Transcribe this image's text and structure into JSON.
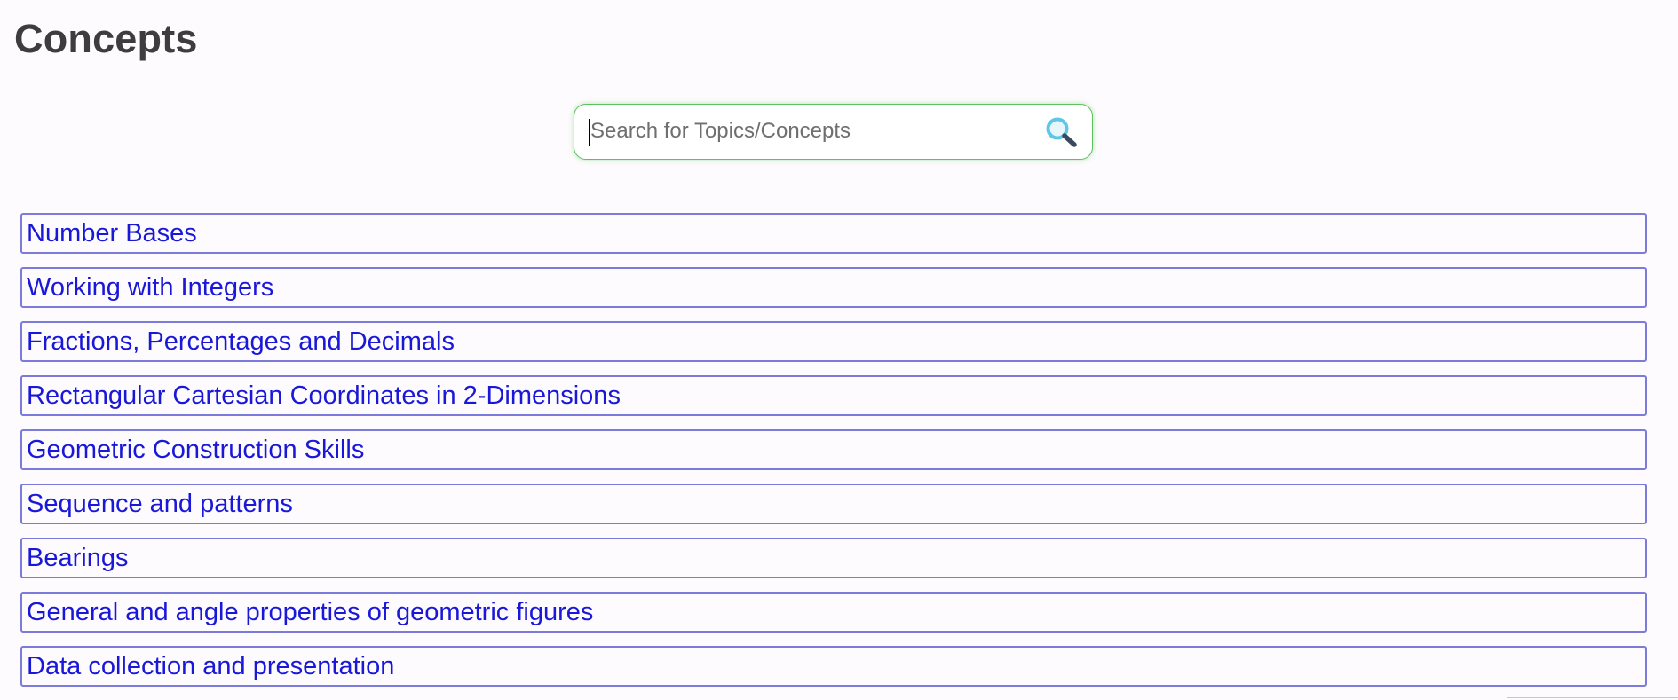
{
  "header": {
    "title": "Concepts"
  },
  "search": {
    "placeholder": "Search for Topics/Concepts",
    "value": "",
    "icon": "search-icon"
  },
  "concepts": [
    {
      "label": "Number Bases"
    },
    {
      "label": "Working with Integers"
    },
    {
      "label": "Fractions, Percentages and Decimals"
    },
    {
      "label": "Rectangular Cartesian Coordinates in 2-Dimensions"
    },
    {
      "label": "Geometric Construction Skills"
    },
    {
      "label": "Sequence and patterns"
    },
    {
      "label": "Bearings"
    },
    {
      "label": "General and angle properties of geometric figures"
    },
    {
      "label": "Data collection and presentation"
    }
  ],
  "colors": {
    "title": "#3d3d3d",
    "link": "#1a18d8",
    "item_border": "#7b7bdb",
    "search_border": "#5cc25c",
    "background": "#fdfbfd"
  }
}
